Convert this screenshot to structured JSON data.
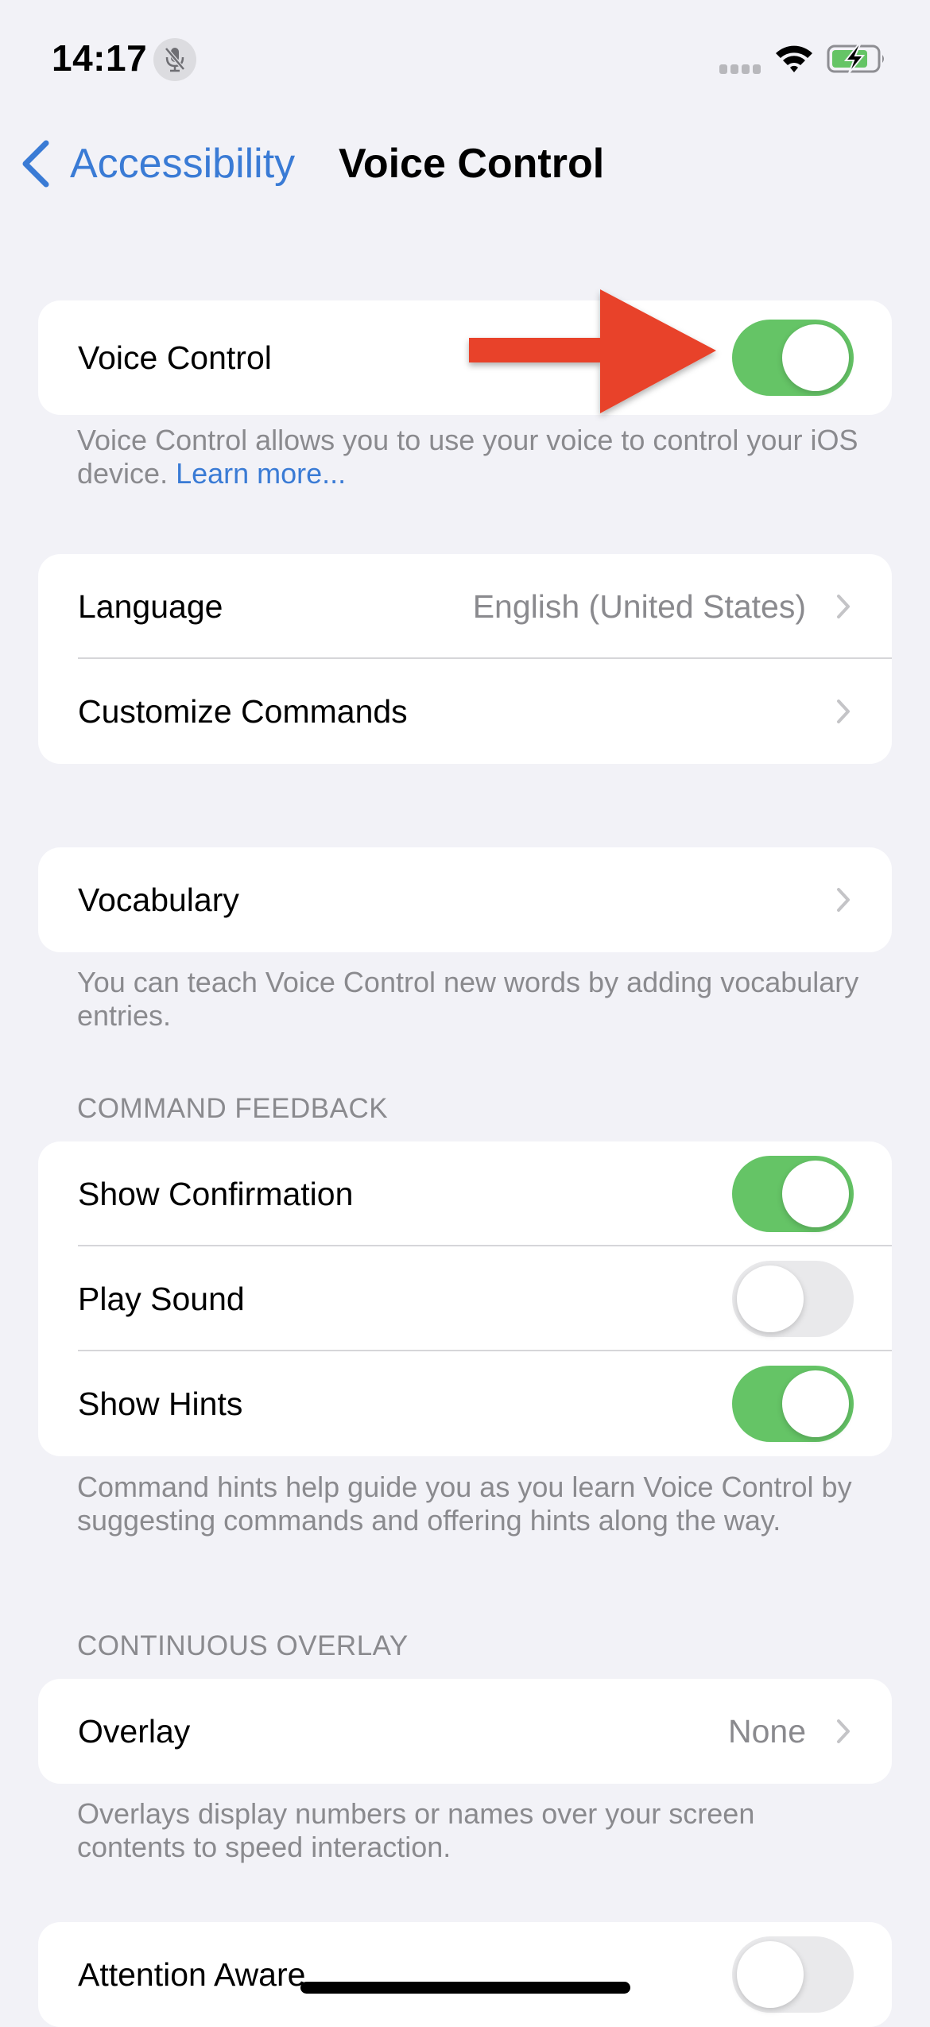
{
  "status_bar": {
    "time": "14:17",
    "mic_icon": "mic-muted-icon",
    "signal_icon": "signal-dots-icon",
    "wifi_icon": "wifi-icon",
    "battery_icon": "battery-charging-icon",
    "battery_level": 0.7
  },
  "nav": {
    "back_label": "Accessibility",
    "title": "Voice Control"
  },
  "colors": {
    "accent": "#3a7bd5",
    "toggle_on": "#65c466",
    "toggle_off": "#e9e9eb",
    "annotation_arrow": "#e8432a",
    "background": "#f2f2f7"
  },
  "main_toggle": {
    "label": "Voice Control",
    "on": true,
    "footer_text": "Voice Control allows you to use your voice to control your iOS device. ",
    "footer_link": "Learn more..."
  },
  "settings_group": {
    "rows": [
      {
        "label": "Language",
        "value": "English (United States)"
      },
      {
        "label": "Customize Commands",
        "value": ""
      }
    ]
  },
  "vocabulary": {
    "label": "Vocabulary",
    "footer_text": "You can teach Voice Control new words by adding vocabulary entries."
  },
  "command_feedback": {
    "header": "COMMAND FEEDBACK",
    "rows": [
      {
        "label": "Show Confirmation",
        "on": true
      },
      {
        "label": "Play Sound",
        "on": false
      },
      {
        "label": "Show Hints",
        "on": true
      }
    ],
    "footer_text": "Command hints help guide you as you learn Voice Control by suggesting commands and offering hints along the way."
  },
  "continuous_overlay": {
    "header": "CONTINUOUS OVERLAY",
    "label": "Overlay",
    "value": "None",
    "footer_text": "Overlays display numbers or names over your screen contents to speed interaction."
  },
  "attention": {
    "label": "Attention Aware",
    "on": false
  }
}
